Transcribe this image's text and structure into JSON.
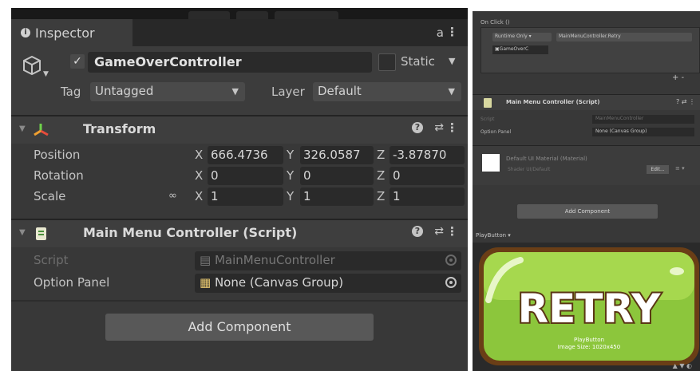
{
  "inspector": {
    "tab_label": "Inspector",
    "game_object": {
      "name": "GameOverController",
      "static_label": "Static",
      "tag_label": "Tag",
      "tag_value": "Untagged",
      "layer_label": "Layer",
      "layer_value": "Default"
    },
    "transform": {
      "title": "Transform",
      "rows": [
        {
          "label": "Position",
          "x": "666.4736",
          "y": "326.0587",
          "z": "-3.87870"
        },
        {
          "label": "Rotation",
          "x": "0",
          "y": "0",
          "z": "0"
        },
        {
          "label": "Scale",
          "x": "1",
          "y": "1",
          "z": "1"
        }
      ],
      "axis": {
        "x": "X",
        "y": "Y",
        "z": "Z"
      }
    },
    "script_component": {
      "title": "Main Menu Controller (Script)",
      "script_label": "Script",
      "script_value": "MainMenuController",
      "option_label": "Option Panel",
      "option_value": "None (Canvas Group)"
    },
    "add_component_label": "Add Component"
  },
  "right_panel": {
    "onclick_label": "On Click ()",
    "runtime_dd": "Runtime Only",
    "function_dd": "MainMenuController.Retry",
    "target_obj": "GameOverC",
    "plus_minus": "+ -",
    "component_title": "Main Menu Controller (Script)",
    "script_label": "Script",
    "script_value": "MainMenuController",
    "option_label": "Option Panel",
    "option_value": "None (Canvas Group)",
    "material_name": "Default UI Material (Material)",
    "shader_label": "Shader",
    "shader_value": "UI/Default",
    "edit_label": "Edit...",
    "add_component_label": "Add Component",
    "preview_label": "PlayButton",
    "button_text": "RETRY",
    "preview_caption_1": "PlayButton",
    "preview_caption_2": "Image Size: 1020x450"
  },
  "colors": {
    "panel_bg": "#383838",
    "header_bg": "#3c3c3c",
    "field_bg": "#2a2a2a",
    "button_bg": "#585858",
    "retry_green": "#8cc63c",
    "retry_border": "#6a3e16"
  },
  "icons": {
    "tab": "info-icon",
    "lock": "lock-icon",
    "menu": "kebab-menu-icon",
    "gameobject": "cube-icon",
    "transform": "transform-axes-icon",
    "script": "script-file-icon",
    "help": "help-icon",
    "presets": "preset-sliders-icon",
    "link": "constrain-proportions-icon",
    "picker": "object-picker-icon"
  }
}
